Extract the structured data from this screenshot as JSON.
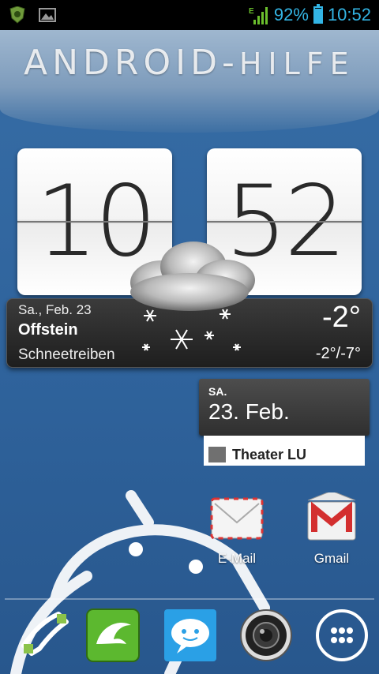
{
  "statusbar": {
    "network": "E",
    "battery_percent": "92%",
    "battery_level": 0.92,
    "time": "10:52",
    "left_icons": [
      "shield-icon",
      "image-notification-icon"
    ]
  },
  "wallpaper": {
    "logo_bold": "ANDROID-",
    "logo_thin": "HILFE"
  },
  "clock": {
    "hours": "10",
    "minutes": "52"
  },
  "weather": {
    "date": "Sa., Feb. 23",
    "city": "Offstein",
    "condition": "Schneetreiben",
    "temperature": "-2°",
    "range": "-2°/-7°"
  },
  "calendar": {
    "day": "SA.",
    "date": "23. Feb.",
    "event": "Theater LU"
  },
  "apps": [
    {
      "label": "E-Mail",
      "icon": "email-icon"
    },
    {
      "label": "Gmail",
      "icon": "gmail-icon"
    }
  ],
  "dock": [
    "phone-icon",
    "dolphin-browser-icon",
    "messaging-icon",
    "camera-icon",
    "app-drawer-icon"
  ]
}
